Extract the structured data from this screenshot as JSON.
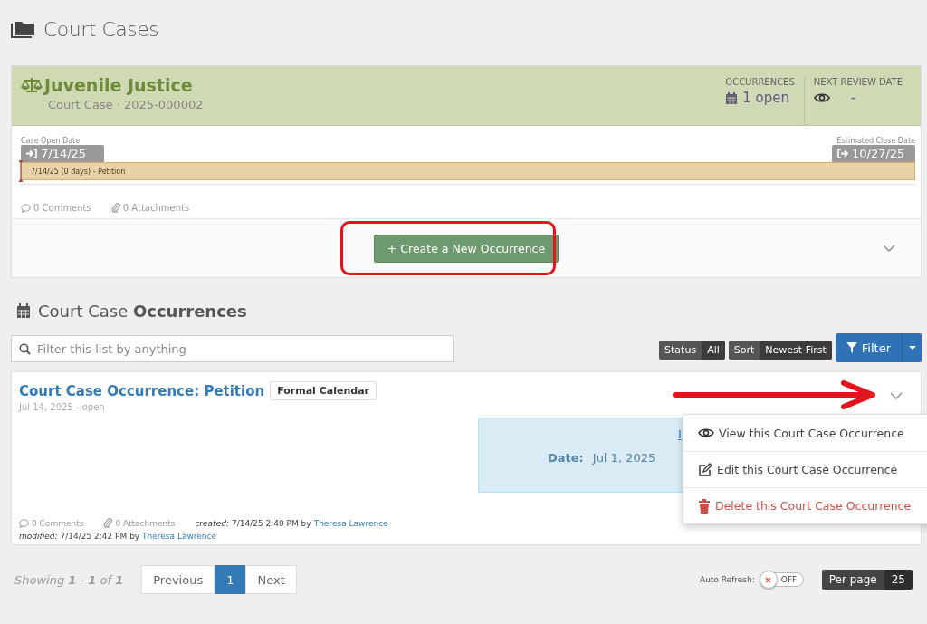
{
  "page_title": "Court Cases",
  "case": {
    "title": "Juvenile Justice",
    "subtitle": "Court Case · 2025-000002",
    "stats": [
      {
        "kind": "occurrences",
        "label": "OCCURRENCES",
        "value": "1 open"
      },
      {
        "kind": "review",
        "label": "NEXT REVIEW DATE",
        "value": "-"
      }
    ],
    "open_date_label": "Case Open Date",
    "open_date": "7/14/25",
    "close_date_label": "Estimated Close Date",
    "close_date": "10/27/25",
    "timeline_label": "7/14/25 (0 days) - Petition",
    "comments": "0 Comments",
    "attachments": "0 Attachments",
    "create_button": "+ Create a New Occurrence",
    "expanded": false
  },
  "section_title": "Court Case **Occurrences**",
  "filter": {
    "placeholder": "Filter this list by anything"
  },
  "chips": [
    {
      "label": "Status",
      "value": "All"
    },
    {
      "label": "Sort",
      "value": "Newest First"
    }
  ],
  "filter_button": "Filter",
  "occurrence": {
    "title": "Court Case Occurrence: Petition",
    "tag": "Formal Calendar",
    "subtitle": "Jul 14, 2025 - open",
    "info_link": "I",
    "date_label": "Date:",
    "date_value": "Jul 1, 2025",
    "comments": "0 Comments",
    "attachments": "0 Attachments",
    "created_label": "created:",
    "created_text": "7/14/25 2:40 PM by",
    "created_by": "Theresa Lawrence",
    "modified_label": "modified:",
    "modified_text": "7/14/25 2:42 PM by",
    "modified_by": "Theresa Lawrence"
  },
  "menu": [
    {
      "kind": "view",
      "label": "View this Court Case Occurrence"
    },
    {
      "kind": "edit",
      "label": "Edit this Court Case Occurrence"
    },
    {
      "kind": "delete",
      "label": "Delete this Court Case Occurrence"
    }
  ],
  "showing": "Showing **1** - **1** of **1**",
  "pages": [
    {
      "label": "Previous",
      "selected": false
    },
    {
      "label": "1",
      "selected": true
    },
    {
      "label": "Next",
      "selected": false
    }
  ],
  "auto_refresh": {
    "label": "Auto Refresh:",
    "on": false,
    "state_text": "OFF"
  },
  "per_page": {
    "label": "Per page",
    "value": "25"
  }
}
